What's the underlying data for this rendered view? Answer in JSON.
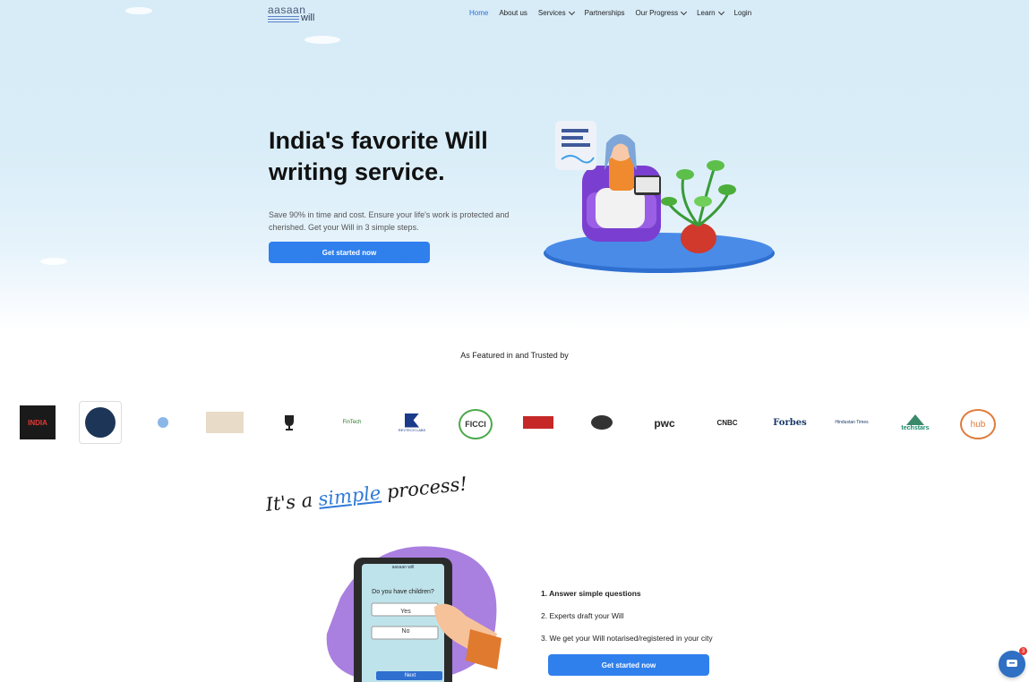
{
  "brand": {
    "logo_line1": "aasaan",
    "logo_line2": "will"
  },
  "nav": {
    "items": [
      {
        "label": "Home"
      },
      {
        "label": "About us"
      },
      {
        "label": "Services"
      },
      {
        "label": "Partnerships"
      },
      {
        "label": "Our Progress"
      },
      {
        "label": "Learn"
      },
      {
        "label": "Login"
      }
    ]
  },
  "hero": {
    "title": "India's favorite Will writing service.",
    "subtitle": "Save 90% in time and cost. Ensure your life's work is protected and cherished. Get your Will in 3 simple steps.",
    "cta": "Get started now"
  },
  "featured": {
    "heading": "As Featured in and Trusted by",
    "logos": [
      "INDIA",
      "",
      "",
      "",
      "",
      "FinTech",
      "REVTECH LABS",
      "FICCI",
      "",
      "",
      "pwc",
      "CNBC",
      "Forbes",
      "Hindustan Times",
      "techstars",
      "hub"
    ]
  },
  "process": {
    "title_pre": "It's a ",
    "title_hl": "simple",
    "title_post": " process!",
    "tablet": {
      "logo": "aasaan will",
      "question": "Do you have children?",
      "yes": "Yes",
      "no": "No",
      "next": "Next"
    },
    "steps": [
      "1. Answer simple questions",
      "2. Experts draft your Will",
      "3. We get your Will notarised/registered in your city"
    ],
    "cta": "Get started now"
  },
  "chat": {
    "badge": "3"
  },
  "colors": {
    "accent": "#2f80ed",
    "hero_bg": "#d8ecf8",
    "purple": "#9b6fd8"
  }
}
